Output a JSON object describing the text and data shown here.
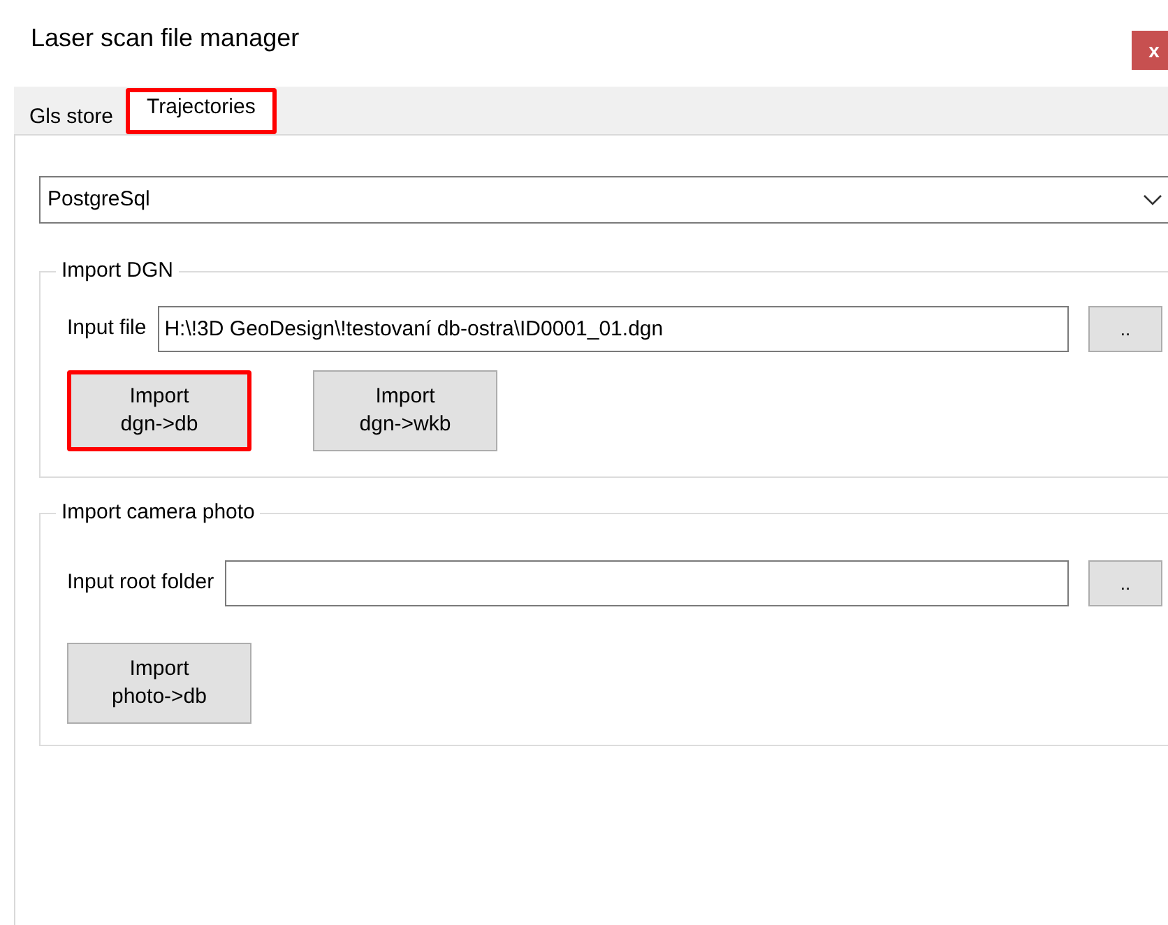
{
  "window": {
    "title": "Laser scan file manager",
    "close": "x"
  },
  "tabs": [
    {
      "label": "Gls store",
      "selected": false,
      "highlighted": false
    },
    {
      "label": "Trajectories",
      "selected": true,
      "highlighted": true
    }
  ],
  "database": {
    "value": "PostgreSql"
  },
  "groups": [
    {
      "title": "Import DGN",
      "field_label": "Input file",
      "value": "H:\\!3D GeoDesign\\!testovaní db-ostra\\ID0001_01.dgn",
      "browse": "..",
      "buttons": [
        {
          "label": "Import\ndgn->db",
          "highlighted": true
        },
        {
          "label": "Import\ndgn->wkb",
          "highlighted": false
        }
      ]
    },
    {
      "title": "Import camera photo",
      "field_label": "Input root folder",
      "browse": "..",
      "buttons": [
        {
          "label": "Import\nphoto->db",
          "highlighted": false
        }
      ]
    }
  ]
}
